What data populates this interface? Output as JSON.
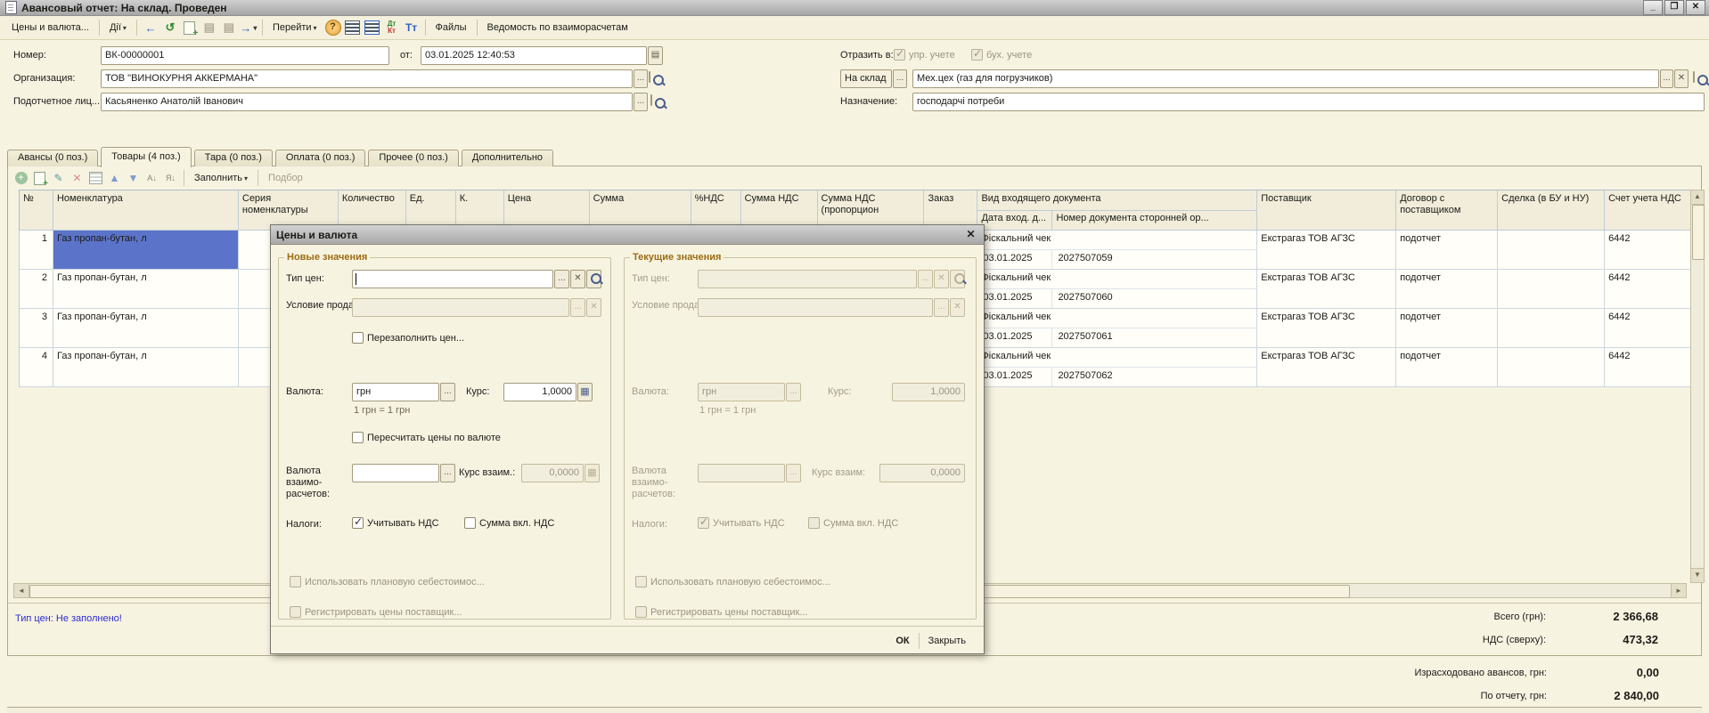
{
  "window": {
    "title": "Авансовый отчет: На склад. Проведен",
    "minimize": "_",
    "restore": "❐",
    "close": "✕"
  },
  "icons": {
    "dropdown": "▾",
    "ellipsis": "...",
    "clear": "✕",
    "calendar": "▤",
    "calculator": "▦",
    "save_close": "←",
    "refresh": "↺",
    "post": "→",
    "help": "?",
    "plus": "+",
    "pencil": "✎",
    "cross": "✕",
    "up": "▲",
    "down": "▼",
    "sort_asc": "А↓",
    "sort_desc": "Я↓",
    "left": "◄",
    "right": "►",
    "dt": "Дт",
    "kt": "Кт",
    "tt": "Тт"
  },
  "toolbar": {
    "prices_button": "Цены и валюта...",
    "actions_button": "Дії",
    "go_button": "Перейти",
    "files_button": "Файлы",
    "statement_button": "Ведомость по взаиморасчетам"
  },
  "header": {
    "number_label": "Номер:",
    "number_value": "ВК-00000001",
    "date_label": "от:",
    "date_value": "03.01.2025 12:40:53",
    "org_label": "Организация:",
    "org_value": "ТОВ \"ВИНОКУРНЯ АККЕРМАНА\"",
    "person_label": "Подотчетное лиц...",
    "person_value": "Касьяненко Анатолій Іванович",
    "reflect_label": "Отразить в:",
    "reflect_mgmt": {
      "label": "упр. учете",
      "checked": true
    },
    "reflect_acc": {
      "label": "бух. учете",
      "checked": true
    },
    "warehouse_button": "На склад",
    "warehouse_value": "Мех.цех (газ для погрузчиков)",
    "purpose_label": "Назначение:",
    "purpose_value": "господарчі потреби"
  },
  "tabs": [
    {
      "label": "Авансы (0 поз.)",
      "active": false
    },
    {
      "label": "Товары (4 поз.)",
      "active": true
    },
    {
      "label": "Тара (0 поз.)",
      "active": false
    },
    {
      "label": "Оплата (0 поз.)",
      "active": false
    },
    {
      "label": "Прочее (0 поз.)",
      "active": false
    },
    {
      "label": "Дополнительно",
      "active": false
    }
  ],
  "table_toolbar": {
    "fill_button": "Заполнить",
    "pick_button": "Подбор"
  },
  "table": {
    "columns": {
      "num": "№",
      "nomenclature": "Номенклатура",
      "series": "Серия номенклатуры",
      "quantity": "Количество",
      "unit": "Ед.",
      "k": "К.",
      "price": "Цена",
      "sum": "Сумма",
      "vat_percent": "%НДС",
      "vat_sum": "Сумма НДС",
      "vat_sum_prop": "Сумма НДС (пропорцион",
      "order": "Заказ",
      "incoming_doc": "Вид входящего документа",
      "incoming_date": "Дата вход. д...",
      "incoming_number": "Номер документа сторонней ор...",
      "supplier": "Поставщик",
      "contract": "Договор с поставщиком",
      "deal": "Сделка (в БУ и НУ)",
      "account": "Счет учета НДС"
    },
    "rows": [
      {
        "num": "1",
        "nomenclature": "Газ пропан-бутан, л",
        "doc_type": "Фіскальний чек",
        "doc_date": "03.01.2025",
        "doc_number": "2027507059",
        "supplier": "Екстрагаз ТОВ АГЗС",
        "contract": "подотчет",
        "account": "6442"
      },
      {
        "num": "2",
        "nomenclature": "Газ пропан-бутан, л",
        "doc_type": "Фіскальний чек",
        "doc_date": "03.01.2025",
        "doc_number": "2027507060",
        "supplier": "Екстрагаз ТОВ АГЗС",
        "contract": "подотчет",
        "account": "6442"
      },
      {
        "num": "3",
        "nomenclature": "Газ пропан-бутан, л",
        "doc_type": "Фіскальний чек",
        "doc_date": "03.01.2025",
        "doc_number": "2027507061",
        "supplier": "Екстрагаз ТОВ АГЗС",
        "contract": "подотчет",
        "account": "6442"
      },
      {
        "num": "4",
        "nomenclature": "Газ пропан-бутан, л",
        "doc_type": "Фіскальний чек",
        "doc_date": "03.01.2025",
        "doc_number": "2027507062",
        "supplier": "Екстрагаз ТОВ АГЗС",
        "contract": "подотчет",
        "account": "6442"
      }
    ]
  },
  "status": {
    "price_type_warning": "Тип цен: Не заполнено!"
  },
  "totals": {
    "total_label": "Всего (грн):",
    "total_value": "2 366,68",
    "vat_label": "НДС (сверху):",
    "vat_value": "473,32",
    "spent_label": "Израсходовано авансов, грн:",
    "spent_value": "0,00",
    "report_label": "По отчету, грн:",
    "report_value": "2 840,00"
  },
  "dialog": {
    "title": "Цены и валюта",
    "new_group": {
      "title": "Новые значения",
      "price_type_label": "Тип цен:",
      "sales_terms_label": "Условие продаж:",
      "refill_checkbox": "Перезаполнить цен...",
      "currency_label": "Валюта:",
      "currency_value": "грн",
      "rate_label": "Курс:",
      "rate_value": "1,0000",
      "rate_note": "1 грн = 1 грн",
      "recalc_checkbox": "Пересчитать цены по валюте",
      "settlement_currency_label": "Валюта взаимо-расчетов:",
      "mutual_rate_label": "Курс взаим.:",
      "mutual_rate_value": "0,0000",
      "taxes_label": "Налоги:",
      "vat_checkbox": {
        "label": "Учитывать НДС",
        "checked": true
      },
      "vat_included_checkbox": {
        "label": "Сумма вкл. НДС",
        "checked": false
      },
      "planned_cost_checkbox": "Использовать плановую себестоимос...",
      "register_prices_checkbox": "Регистрировать цены поставщик..."
    },
    "current_group": {
      "title": "Текущие значения",
      "price_type_label": "Тип цен:",
      "sales_terms_label": "Условие продаж:",
      "currency_label": "Валюта:",
      "currency_value": "грн",
      "rate_label": "Курс:",
      "rate_value": "1,0000",
      "rate_note": "1 грн = 1 грн",
      "settlement_currency_label": "Валюта взаимо-расчетов:",
      "mutual_rate_label": "Курс взаим:",
      "mutual_rate_value": "0,0000",
      "taxes_label": "Налоги:",
      "vat_checkbox": {
        "label": "Учитывать НДС",
        "checked": true
      },
      "vat_included_checkbox": {
        "label": "Сумма вкл. НДС",
        "checked": false
      },
      "planned_cost_checkbox": "Использовать плановую себестоимос...",
      "register_prices_checkbox": "Регистрировать цены поставщик..."
    },
    "ok_button": "ОК",
    "close_button": "Закрыть"
  }
}
